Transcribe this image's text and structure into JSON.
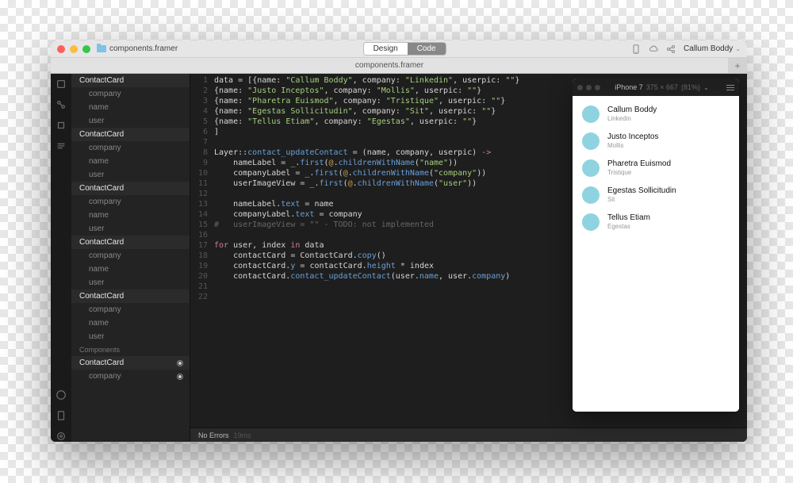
{
  "titlebar": {
    "project": "components.framer",
    "seg_design": "Design",
    "seg_code": "Code",
    "active_segment": "Code",
    "user": "Callum Boddy"
  },
  "tab": {
    "filename": "components.framer",
    "plus": "+"
  },
  "outline": {
    "groups": [
      {
        "title": "ContactCard",
        "children": [
          "company",
          "name",
          "user"
        ]
      },
      {
        "title": "ContactCard",
        "children": [
          "company",
          "name",
          "user"
        ]
      },
      {
        "title": "ContactCard",
        "children": [
          "company",
          "name",
          "user"
        ]
      },
      {
        "title": "ContactCard",
        "children": [
          "company",
          "name",
          "user"
        ]
      },
      {
        "title": "ContactCard",
        "children": [
          "company",
          "name",
          "user"
        ]
      }
    ],
    "section": "Components",
    "component": {
      "title": "ContactCard",
      "child": "company"
    }
  },
  "code": {
    "lines": [
      {
        "n": 1,
        "html": "<span class='tok-var'>data</span> <span class='tok-op'>=</span> [{name: <span class='tok-str'>\"Callum Boddy\"</span>, company: <span class='tok-str'>\"Linkedin\"</span>, userpic: <span class='tok-str'>\"\"</span>}"
      },
      {
        "n": 2,
        "html": "{name: <span class='tok-str'>\"Justo Inceptos\"</span>, company: <span class='tok-str'>\"Mollis\"</span>, userpic: <span class='tok-str'>\"\"</span>}"
      },
      {
        "n": 3,
        "html": "{name: <span class='tok-str'>\"Pharetra Euismod\"</span>, company: <span class='tok-str'>\"Tristique\"</span>, userpic: <span class='tok-str'>\"\"</span>}"
      },
      {
        "n": 4,
        "html": "{name: <span class='tok-str'>\"Egestas Sollicitudin\"</span>, company: <span class='tok-str'>\"Sit\"</span>, userpic: <span class='tok-str'>\"\"</span>}"
      },
      {
        "n": 5,
        "html": "{name: <span class='tok-str'>\"Tellus Etiam\"</span>, company: <span class='tok-str'>\"Egestas\"</span>, userpic: <span class='tok-str'>\"\"</span>}"
      },
      {
        "n": 6,
        "html": "]"
      },
      {
        "n": 7,
        "html": ""
      },
      {
        "n": 8,
        "html": "<span class='tok-var'>Layer</span>::<span class='tok-fn'>contact_updateContact</span> <span class='tok-op'>=</span> (name, company, userpic) <span class='tok-arrow'>-&gt;</span>"
      },
      {
        "n": 9,
        "html": "&nbsp;&nbsp;&nbsp;&nbsp;nameLabel <span class='tok-op'>=</span> _.<span class='tok-fn'>first</span>(<span class='tok-self'>@</span>.<span class='tok-fn'>childrenWithName</span>(<span class='tok-str'>\"name\"</span>))"
      },
      {
        "n": 10,
        "html": "&nbsp;&nbsp;&nbsp;&nbsp;companyLabel <span class='tok-op'>=</span> _.<span class='tok-fn'>first</span>(<span class='tok-self'>@</span>.<span class='tok-fn'>childrenWithName</span>(<span class='tok-str'>\"company\"</span>))"
      },
      {
        "n": 11,
        "html": "&nbsp;&nbsp;&nbsp;&nbsp;userImageView <span class='tok-op'>=</span> _.<span class='tok-fn'>first</span>(<span class='tok-self'>@</span>.<span class='tok-fn'>childrenWithName</span>(<span class='tok-str'>\"user\"</span>))"
      },
      {
        "n": 12,
        "html": ""
      },
      {
        "n": 13,
        "html": "&nbsp;&nbsp;&nbsp;&nbsp;nameLabel.<span class='tok-prop'>text</span> <span class='tok-op'>=</span> name"
      },
      {
        "n": 14,
        "html": "&nbsp;&nbsp;&nbsp;&nbsp;companyLabel.<span class='tok-prop'>text</span> <span class='tok-op'>=</span> company"
      },
      {
        "n": 15,
        "html": "<span class='tok-comment'>#&nbsp;&nbsp;&nbsp;userImageView = \"\" - TODO: not implemented</span>"
      },
      {
        "n": 16,
        "html": ""
      },
      {
        "n": 17,
        "html": "<span class='tok-kw'>for</span> user, index <span class='tok-kw'>in</span> data"
      },
      {
        "n": 18,
        "html": "&nbsp;&nbsp;&nbsp;&nbsp;contactCard <span class='tok-op'>=</span> ContactCard.<span class='tok-fn'>copy</span>()"
      },
      {
        "n": 19,
        "html": "&nbsp;&nbsp;&nbsp;&nbsp;contactCard.<span class='tok-prop'>y</span> <span class='tok-op'>=</span> contactCard.<span class='tok-prop'>height</span> <span class='tok-op'>*</span> index"
      },
      {
        "n": 20,
        "html": "&nbsp;&nbsp;&nbsp;&nbsp;contactCard.<span class='tok-fn'>contact_updateContact</span>(user.<span class='tok-prop'>name</span>, user.<span class='tok-prop'>company</span>)"
      },
      {
        "n": 21,
        "html": ""
      },
      {
        "n": 22,
        "html": ""
      }
    ]
  },
  "status": {
    "label": "No Errors",
    "time": "19ms"
  },
  "preview": {
    "device": "iPhone 7",
    "dims": "375 × 667",
    "scale": "(81%)",
    "contacts": [
      {
        "name": "Callum Boddy",
        "company": "Linkedin"
      },
      {
        "name": "Justo Inceptos",
        "company": "Mollis"
      },
      {
        "name": "Pharetra Euismod",
        "company": "Tristique"
      },
      {
        "name": "Egestas Sollicitudin",
        "company": "Sit"
      },
      {
        "name": "Tellus Etiam",
        "company": "Egestas"
      }
    ]
  }
}
